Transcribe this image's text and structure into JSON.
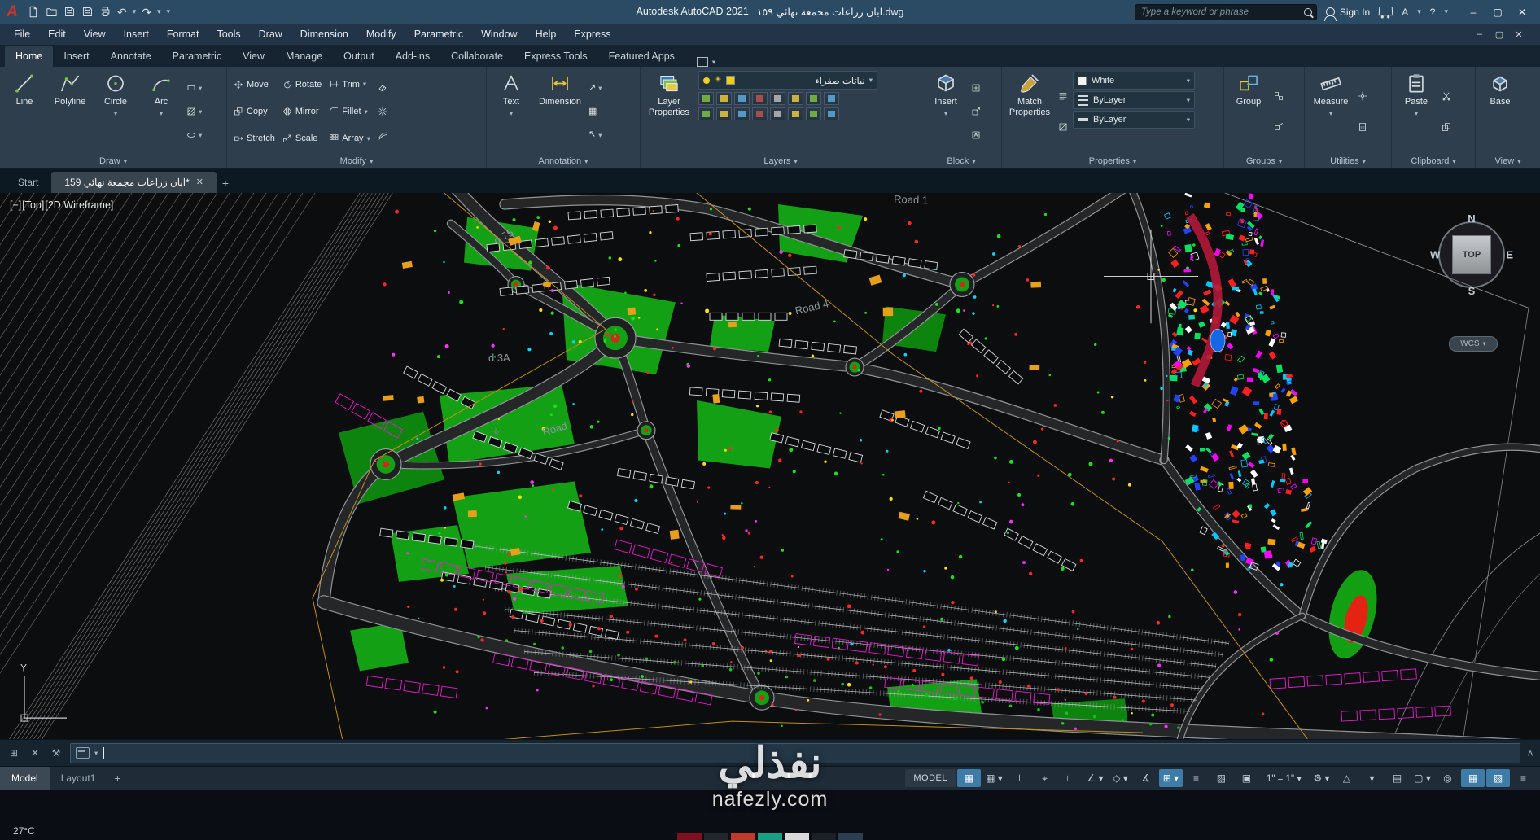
{
  "icons": {
    "logo": "A",
    "caret_down": "▾",
    "undo": "↶",
    "redo": "↷",
    "close": "✕",
    "minimize": "–",
    "maximize": "▢",
    "help": "?",
    "apps": "A",
    "plus": "+",
    "leader": "↗",
    "table": "▦",
    "multileader": "↖",
    "cmd_grid": "⊞",
    "cmd_wrench": "⚒",
    "scroll_up": "˄",
    "sun": "☀"
  },
  "tit极lebar": {},
  "titlebar": {
    "app_title": "Autodesk AutoCAD 2021",
    "doc_name": "ابان زراعات مجمعة نهائي ١٥٩.dwg",
    "search_placeholder": "Type a keyword or phrase",
    "sign_in": "Sign In"
  },
  "menubar": [
    "File",
    "Edit",
    "View",
    "Insert",
    "Format",
    "Tools",
    "Draw",
    "Dimension",
    "Modify",
    "Parametric",
    "Window",
    "Help",
    "Express"
  ],
  "ribbon": {
    "tabs": [
      {
        "label": "Home",
        "active": true
      },
      {
        "label": "Insert"
      },
      {
        "label": "Annotate"
      },
      {
        "label": "Parametric"
      },
      {
        "label": "View"
      },
      {
        "label": "Manage"
      },
      {
        "label": "Output"
      },
      {
        "label": "Add-ins"
      },
      {
        "label": "Collaborate"
      },
      {
        "label": "Express Tools"
      },
      {
        "label": "Featured Apps"
      }
    ],
    "draw": {
      "label": "Draw",
      "line": "Line",
      "polyline": "Polyline",
      "circle": "Circle",
      "arc": "Arc"
    },
    "modify": {
      "label": "Modify",
      "move": "Move",
      "copy": "Copy",
      "stretch": "Stretch",
      "rotate": "Rotate",
      "mirror": "Mirror",
      "scale": "Scale",
      "trim": "Trim",
      "fillet": "Fillet",
      "array": "Array"
    },
    "annotation": {
      "label": "Annotation",
      "text": "Text",
      "dimension": "Dimension"
    },
    "layers": {
      "label": "Layers",
      "layer_properties": "Layer Properties",
      "current_layer": "نباتات صفراء"
    },
    "block": {
      "label": "Block",
      "insert": "Insert"
    },
    "properties": {
      "label": "Properties",
      "match": "Match Properties",
      "color": "White",
      "linetype": "ByLayer",
      "lineweight": "ByLayer"
    },
    "groups": {
      "label": "Groups",
      "group": "Group"
    },
    "utilities": {
      "label": "Utilities",
      "measure": "Measure"
    },
    "clipboard": {
      "label": "Clipboard",
      "paste": "Paste"
    },
    "view": {
      "label": "View",
      "base": "Base"
    }
  },
  "doc_tabs": {
    "start": "Start",
    "active": "ابان زراعات مجمعة نهائي 159*"
  },
  "viewport": {
    "controls": {
      "minimize": "[−]",
      "view": "[Top]",
      "visual_style": "[2D Wireframe]"
    },
    "viewcube": {
      "n": "N",
      "e": "E",
      "s": "S",
      "w": "W",
      "top": "TOP",
      "wcs": "WCS"
    },
    "axis_y": "Y",
    "labels": [
      "Road 1",
      "Road 4",
      "Road",
      "d 3A",
      "d 75"
    ]
  },
  "statusbar": {
    "model_tab": "Model",
    "layout_tab": "Layout1",
    "model_button": "MODEL",
    "scale": "1\" = 1\" ▾",
    "left_icons": [
      {
        "name": "grid-display",
        "glyph": "▦",
        "active": true
      },
      {
        "name": "snap-mode",
        "glyph": "▦ ▾"
      },
      {
        "name": "infer-constraints",
        "glyph": "⊥"
      },
      {
        "name": "dynamic-input",
        "glyph": "⌖"
      },
      {
        "name": "ortho-mode",
        "glyph": "∟"
      },
      {
        "name": "polar-tracking",
        "glyph": "∠ ▾"
      },
      {
        "name": "isometric-drafting",
        "glyph": "◇ ▾"
      },
      {
        "name": "object-snap-tracking",
        "glyph": "∡"
      },
      {
        "name": "object-snap",
        "glyph": "⊞ ▾",
        "active": true
      },
      {
        "name": "lineweight-display",
        "glyph": "≡"
      },
      {
        "name": "transparency",
        "glyph": "▨"
      },
      {
        "name": "selection-cycling",
        "glyph": "▣"
      }
    ],
    "right_icons": [
      {
        "name": "workspace-switching",
        "glyph": "⚙ ▾"
      },
      {
        "name": "annotation-monitor",
        "glyph": "△"
      },
      {
        "name": "current-units",
        "glyph": "▾"
      },
      {
        "name": "quick-properties",
        "glyph": "▤"
      },
      {
        "name": "lock-ui",
        "glyph": "▢ ▾"
      },
      {
        "name": "isolate-objects",
        "glyph": "◎"
      },
      {
        "name": "graphics-performance",
        "glyph": "▦",
        "active": true
      },
      {
        "name": "clean-screen",
        "glyph": "▧",
        "active": true
      },
      {
        "name": "customization",
        "glyph": "≡"
      }
    ]
  },
  "watermark": {
    "title": "نفذلي",
    "site": "nafezly.com"
  },
  "taskbar": {
    "temperature": "27°C"
  }
}
